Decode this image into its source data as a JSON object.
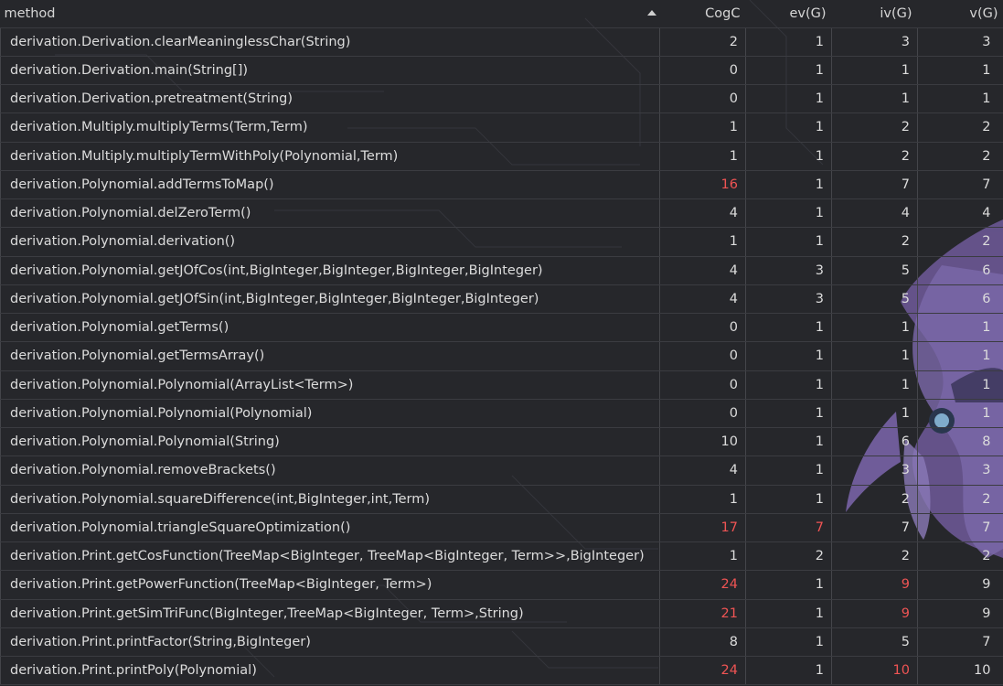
{
  "columns": {
    "method": "method",
    "cogc": "CogC",
    "ev": "ev(G)",
    "iv": "iv(G)",
    "v": "v(G)"
  },
  "sort": {
    "column": "method",
    "direction": "ascending",
    "icon": "sort-up-icon"
  },
  "accent": {
    "highlight": "#ef5454",
    "text": "#dcdcdc",
    "background": "#26272b"
  },
  "rows": [
    {
      "method": "derivation.Derivation.clearMeaninglessChar(String)",
      "cogc": "2",
      "ev": "1",
      "iv": "3",
      "v": "3"
    },
    {
      "method": "derivation.Derivation.main(String[])",
      "cogc": "0",
      "ev": "1",
      "iv": "1",
      "v": "1"
    },
    {
      "method": "derivation.Derivation.pretreatment(String)",
      "cogc": "0",
      "ev": "1",
      "iv": "1",
      "v": "1"
    },
    {
      "method": "derivation.Multiply.multiplyTerms(Term,Term)",
      "cogc": "1",
      "ev": "1",
      "iv": "2",
      "v": "2"
    },
    {
      "method": "derivation.Multiply.multiplyTermWithPoly(Polynomial,Term)",
      "cogc": "1",
      "ev": "1",
      "iv": "2",
      "v": "2"
    },
    {
      "method": "derivation.Polynomial.addTermsToMap()",
      "cogc": "16",
      "ev": "1",
      "iv": "7",
      "v": "7",
      "hot": [
        "cogc"
      ]
    },
    {
      "method": "derivation.Polynomial.delZeroTerm()",
      "cogc": "4",
      "ev": "1",
      "iv": "4",
      "v": "4"
    },
    {
      "method": "derivation.Polynomial.derivation()",
      "cogc": "1",
      "ev": "1",
      "iv": "2",
      "v": "2"
    },
    {
      "method": "derivation.Polynomial.getJOfCos(int,BigInteger,BigInteger,BigInteger,BigInteger)",
      "cogc": "4",
      "ev": "3",
      "iv": "5",
      "v": "6"
    },
    {
      "method": "derivation.Polynomial.getJOfSin(int,BigInteger,BigInteger,BigInteger,BigInteger)",
      "cogc": "4",
      "ev": "3",
      "iv": "5",
      "v": "6"
    },
    {
      "method": "derivation.Polynomial.getTerms()",
      "cogc": "0",
      "ev": "1",
      "iv": "1",
      "v": "1"
    },
    {
      "method": "derivation.Polynomial.getTermsArray()",
      "cogc": "0",
      "ev": "1",
      "iv": "1",
      "v": "1"
    },
    {
      "method": "derivation.Polynomial.Polynomial(ArrayList<Term>)",
      "cogc": "0",
      "ev": "1",
      "iv": "1",
      "v": "1"
    },
    {
      "method": "derivation.Polynomial.Polynomial(Polynomial)",
      "cogc": "0",
      "ev": "1",
      "iv": "1",
      "v": "1"
    },
    {
      "method": "derivation.Polynomial.Polynomial(String)",
      "cogc": "10",
      "ev": "1",
      "iv": "6",
      "v": "8"
    },
    {
      "method": "derivation.Polynomial.removeBrackets()",
      "cogc": "4",
      "ev": "1",
      "iv": "3",
      "v": "3"
    },
    {
      "method": "derivation.Polynomial.squareDifference(int,BigInteger,int,Term)",
      "cogc": "1",
      "ev": "1",
      "iv": "2",
      "v": "2"
    },
    {
      "method": "derivation.Polynomial.triangleSquareOptimization()",
      "cogc": "17",
      "ev": "7",
      "iv": "7",
      "v": "7",
      "hot": [
        "cogc",
        "ev"
      ]
    },
    {
      "method": "derivation.Print.getCosFunction(TreeMap<BigInteger, TreeMap<BigInteger, Term>>,BigInteger)",
      "cogc": "1",
      "ev": "2",
      "iv": "2",
      "v": "2"
    },
    {
      "method": "derivation.Print.getPowerFunction(TreeMap<BigInteger, Term>)",
      "cogc": "24",
      "ev": "1",
      "iv": "9",
      "v": "9",
      "hot": [
        "cogc",
        "iv"
      ]
    },
    {
      "method": "derivation.Print.getSimTriFunc(BigInteger,TreeMap<BigInteger, Term>,String)",
      "cogc": "21",
      "ev": "1",
      "iv": "9",
      "v": "9",
      "hot": [
        "cogc",
        "iv"
      ]
    },
    {
      "method": "derivation.Print.printFactor(String,BigInteger)",
      "cogc": "8",
      "ev": "1",
      "iv": "5",
      "v": "7"
    },
    {
      "method": "derivation.Print.printPoly(Polynomial)",
      "cogc": "24",
      "ev": "1",
      "iv": "10",
      "v": "10",
      "hot": [
        "cogc",
        "iv"
      ]
    }
  ]
}
